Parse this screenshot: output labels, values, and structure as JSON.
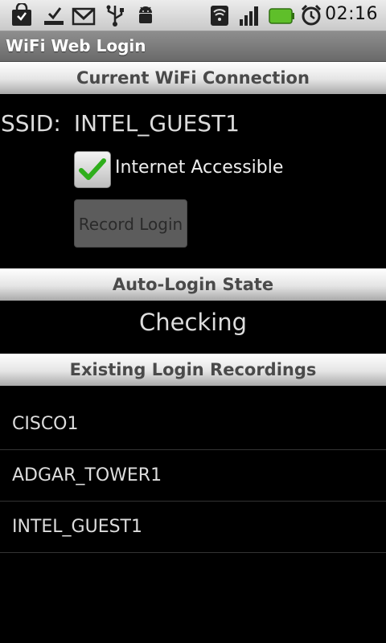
{
  "status_bar": {
    "icons_left": [
      "shopping-bag-icon",
      "download-icon",
      "gmail-icon",
      "usb-icon",
      "android-debug-icon"
    ],
    "icons_right": [
      "wifi-icon",
      "signal-icon",
      "battery-icon",
      "alarm-icon"
    ],
    "time": "02:16"
  },
  "app": {
    "title": "WiFi Web Login"
  },
  "current_connection": {
    "header": "Current WiFi Connection",
    "ssid_label": "SSID:",
    "ssid_value": "INTEL_GUEST1",
    "internet_label": "Internet Accessible",
    "internet_checked": true,
    "record_button": "Record Login"
  },
  "auto_login": {
    "header": "Auto-Login State",
    "state": "Checking"
  },
  "recordings": {
    "header": "Existing Login Recordings",
    "items": [
      "CISCO1",
      "ADGAR_TOWER1",
      "INTEL_GUEST1"
    ]
  },
  "colors": {
    "battery_green": "#5fbf2a",
    "checkmark_green": "#2fae1c"
  }
}
